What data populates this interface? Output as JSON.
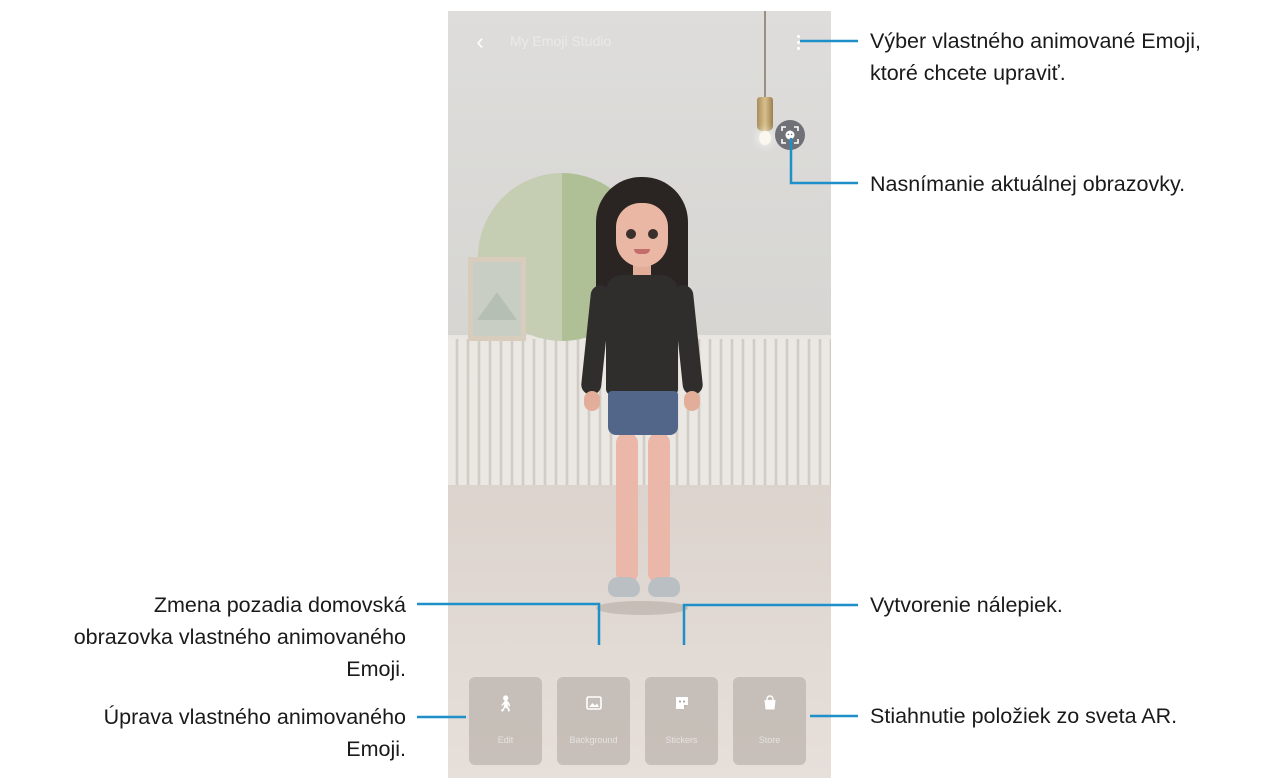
{
  "app": {
    "title": "My Emoji Studio",
    "back_icon": "chevron-left-icon",
    "more_icon": "more-vertical-icon",
    "capture_icon": "face-scan-icon"
  },
  "actions": [
    {
      "label": "Edit",
      "icon": "person-icon"
    },
    {
      "label": "Background",
      "icon": "image-icon"
    },
    {
      "label": "Stickers",
      "icon": "sticker-icon"
    },
    {
      "label": "Store",
      "icon": "shopping-bag-icon"
    }
  ],
  "callouts": {
    "more_line1": "Výber vlastného animované Emoji,",
    "more_line2": "ktoré chcete upraviť.",
    "capture": "Nasnímanie aktuálnej obrazovky.",
    "stickers": "Vytvorenie nálepiek.",
    "store": "Stiahnutie položiek zo sveta AR.",
    "background_line1": "Zmena pozadia domovská",
    "background_line2": "obrazovka vlastného animovaného",
    "background_line3": "Emoji.",
    "edit_line1": "Úprava vlastného animovaného",
    "edit_line2": "Emoji."
  },
  "colors": {
    "callout_line": "#1e8fc8"
  }
}
